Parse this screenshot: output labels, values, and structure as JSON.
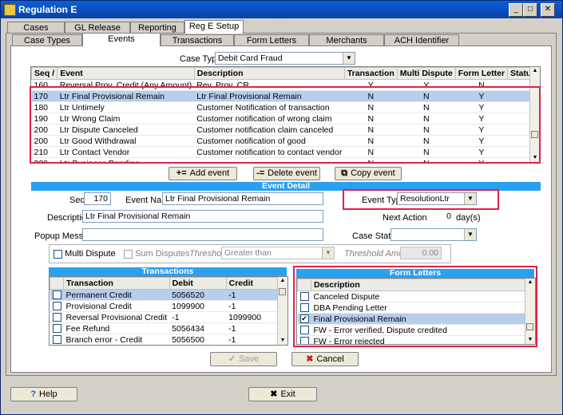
{
  "window": {
    "title": "Regulation E"
  },
  "main_tabs": [
    {
      "label": "Cases"
    },
    {
      "label": "GL Release"
    },
    {
      "label": "Reporting"
    },
    {
      "label": "Reg E Setup"
    }
  ],
  "sub_tabs": [
    {
      "label": "Case Types"
    },
    {
      "label": "Events"
    },
    {
      "label": "Transactions"
    },
    {
      "label": "Form Letters"
    },
    {
      "label": "Merchants"
    },
    {
      "label": "ACH Identifier"
    }
  ],
  "case_type": {
    "label": "Case Type",
    "value": "Debit Card Fraud"
  },
  "events_grid": {
    "columns": [
      "Seq",
      "Event",
      "Description",
      "Transaction",
      "Multi Dispute",
      "Form Letter",
      "Status"
    ],
    "rows": [
      {
        "seq": "160",
        "event": "Reversal Prov. Credit (Any Amount)",
        "description": "Rev. Prov. CR",
        "transaction": "Y",
        "multi": "Y",
        "letter": "N",
        "status": ""
      },
      {
        "seq": "170",
        "event": "Ltr Final Provisional Remain",
        "description": "Ltr Final Provisional Remain",
        "transaction": "N",
        "multi": "N",
        "letter": "Y",
        "status": ""
      },
      {
        "seq": "180",
        "event": "Ltr Untimely",
        "description": "Customer Notification of transaction",
        "transaction": "N",
        "multi": "N",
        "letter": "Y",
        "status": ""
      },
      {
        "seq": "190",
        "event": "Ltr Wrong Claim",
        "description": "Customer notification of wrong claim",
        "transaction": "N",
        "multi": "N",
        "letter": "Y",
        "status": ""
      },
      {
        "seq": "200",
        "event": "Ltr Dispute Canceled",
        "description": "Customer notification claim canceled",
        "transaction": "N",
        "multi": "N",
        "letter": "Y",
        "status": ""
      },
      {
        "seq": "200",
        "event": "Ltr Good Withdrawal",
        "description": "Customer notification of good",
        "transaction": "N",
        "multi": "N",
        "letter": "Y",
        "status": ""
      },
      {
        "seq": "210",
        "event": "Ltr Contact Vendor",
        "description": "Customer notification to contact vendor",
        "transaction": "N",
        "multi": "N",
        "letter": "Y",
        "status": ""
      },
      {
        "seq": "220",
        "event": "Ltr-Business Pending",
        "description": "",
        "transaction": "N",
        "multi": "N",
        "letter": "Y",
        "status": ""
      }
    ]
  },
  "event_buttons": {
    "add": "Add event",
    "delete": "Delete event",
    "copy": "Copy event"
  },
  "event_detail": {
    "header": "Event Detail",
    "seq_label": "Seq",
    "seq_value": "170",
    "event_name_label": "Event Name",
    "event_name_value": "Ltr Final Provisional Remain",
    "event_type_label": "Event Type",
    "event_type_value": "ResolutionLtr",
    "description_label": "Description",
    "description_value": "Ltr Final Provisional Remain",
    "next_action_label": "Next Action +",
    "next_action_value": "0",
    "days_label": "day(s)",
    "popup_label": "Popup Message",
    "popup_value": "",
    "case_status_label": "Case Status",
    "case_status_value": "",
    "multi_dispute_label": "Multi Dispute",
    "sum_disputes_label": "Sum Disputes",
    "threshold_label": "Threshold",
    "threshold_value": "Greater than",
    "threshold_amount_label": "Threshold Amount",
    "threshold_amount_value": "0.00"
  },
  "transactions": {
    "header": "Transactions",
    "columns": [
      "Transaction",
      "Debit",
      "Credit"
    ],
    "rows": [
      {
        "name": "Permanent Credit",
        "debit": "5056520",
        "credit": "-1"
      },
      {
        "name": "Provisional Credit",
        "debit": "1099900",
        "credit": "-1"
      },
      {
        "name": "Reversal Provisional Credit",
        "debit": "-1",
        "credit": "1099900"
      },
      {
        "name": "Fee Refund",
        "debit": "5056434",
        "credit": "-1"
      },
      {
        "name": "Branch error - Credit",
        "debit": "5056500",
        "credit": "-1"
      }
    ]
  },
  "form_letters": {
    "header": "Form Letters",
    "columns": [
      "Description"
    ],
    "rows": [
      {
        "name": "Canceled Dispute",
        "checked": ""
      },
      {
        "name": "DBA Pending Letter",
        "checked": ""
      },
      {
        "name": "Final Provisional Remain",
        "checked": "✔"
      },
      {
        "name": "FW - Error verified, Dispute credited",
        "checked": ""
      },
      {
        "name": "FW - Error rejected",
        "checked": ""
      }
    ]
  },
  "actions": {
    "save": "Save",
    "cancel": "Cancel"
  },
  "footer": {
    "help": "Help",
    "exit": "Exit"
  },
  "colors": {
    "accent": "#2aa0f0",
    "highlight": "#e0204a",
    "selection": "#b8ceed"
  }
}
